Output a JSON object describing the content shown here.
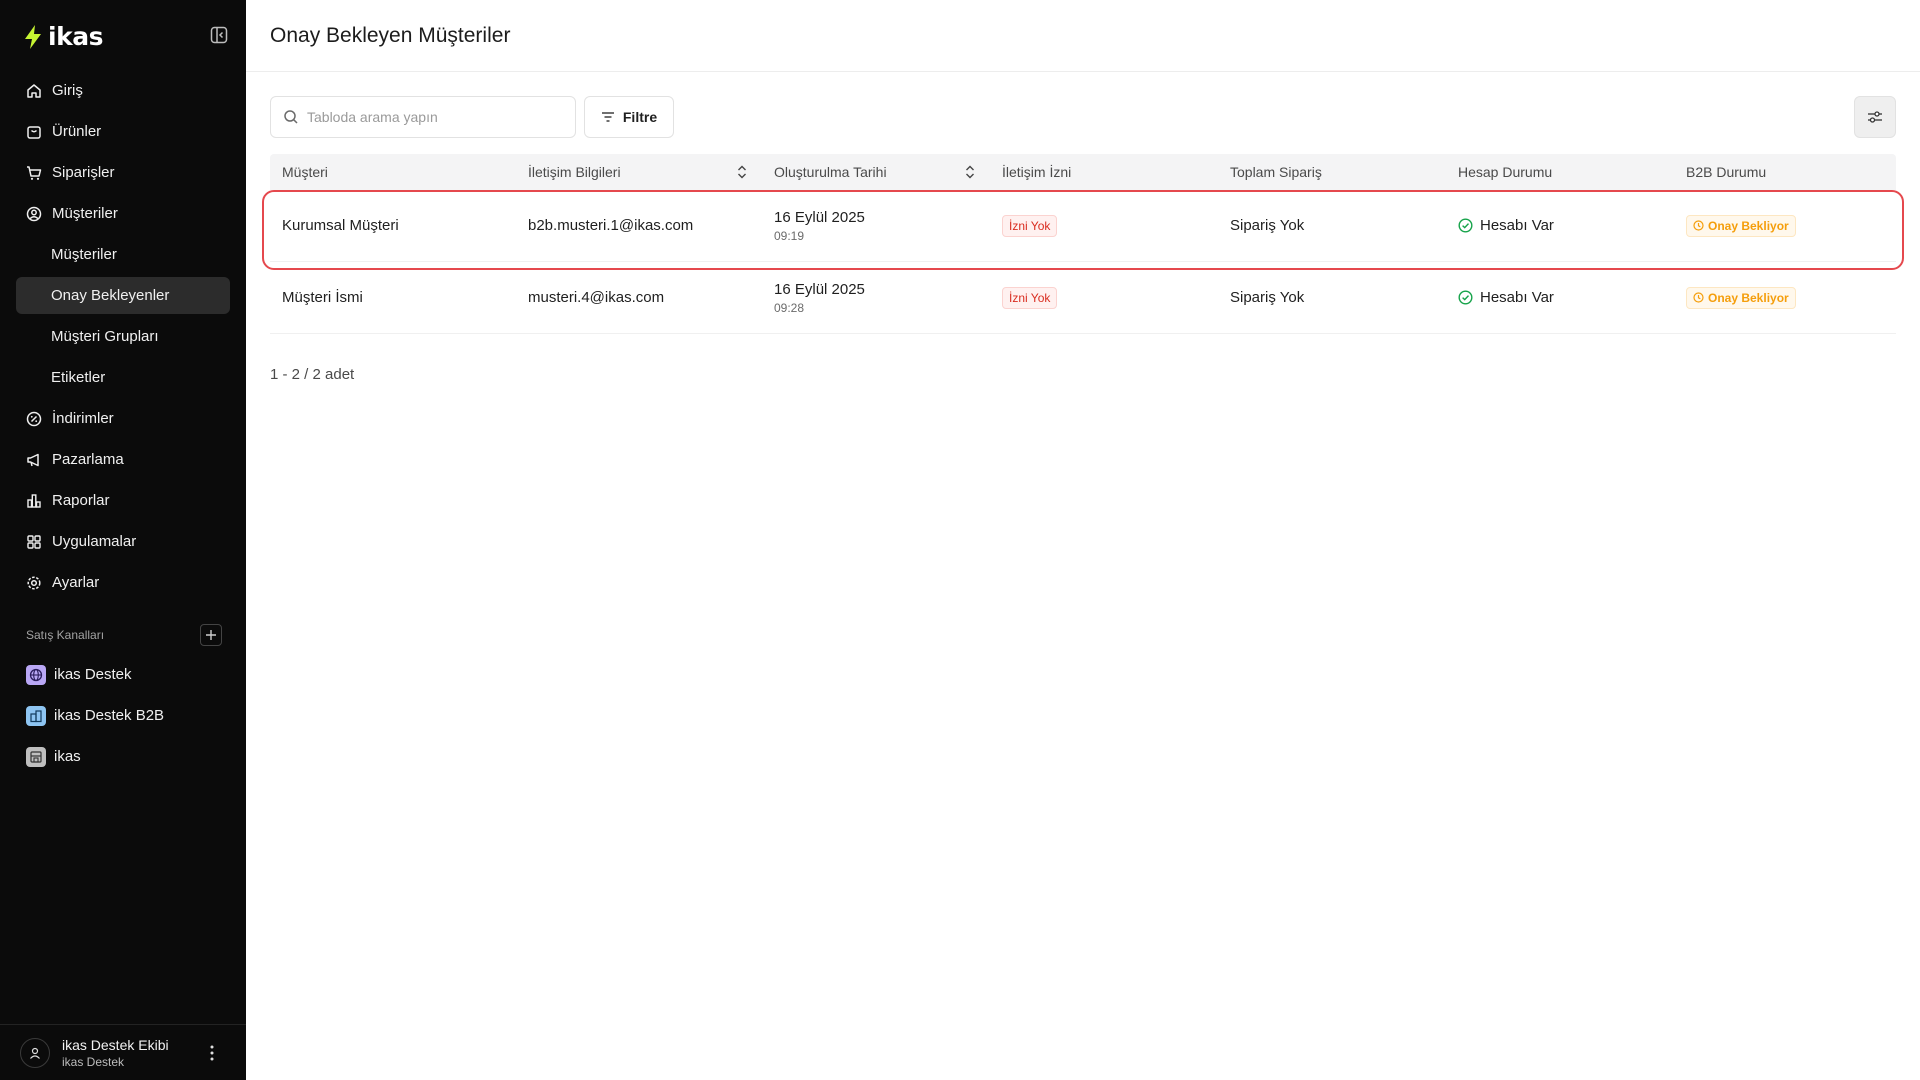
{
  "app": {
    "logo_text": "ikas"
  },
  "sidebar": {
    "items": [
      {
        "label": "Giriş",
        "icon": "home-icon"
      },
      {
        "label": "Ürünler",
        "icon": "box-icon"
      },
      {
        "label": "Siparişler",
        "icon": "cart-icon"
      },
      {
        "label": "Müşteriler",
        "icon": "user-circle-icon"
      },
      {
        "label": "Müşteriler"
      },
      {
        "label": "Onay Bekleyenler",
        "active": true
      },
      {
        "label": "Müşteri Grupları"
      },
      {
        "label": "Etiketler"
      },
      {
        "label": "İndirimler",
        "icon": "discount-icon"
      },
      {
        "label": "Pazarlama",
        "icon": "megaphone-icon"
      },
      {
        "label": "Raporlar",
        "icon": "chart-icon"
      },
      {
        "label": "Uygulamalar",
        "icon": "grid-icon"
      },
      {
        "label": "Ayarlar",
        "icon": "gear-icon"
      }
    ],
    "channels_label": "Satış Kanalları",
    "channels": [
      {
        "label": "ikas Destek",
        "icon": "globe-icon",
        "color": "#b9a7f5"
      },
      {
        "label": "ikas Destek B2B",
        "icon": "building-icon",
        "color": "#8ec5f2"
      },
      {
        "label": "ikas",
        "icon": "store-icon",
        "color": "#bfbfbf"
      }
    ],
    "user": {
      "name": "ikas Destek Ekibi",
      "org": "ikas Destek"
    }
  },
  "page": {
    "title": "Onay Bekleyen Müşteriler"
  },
  "toolbar": {
    "search_placeholder": "Tabloda arama yapın",
    "filter_label": "Filtre"
  },
  "table": {
    "columns": [
      "Müşteri",
      "İletişim Bilgileri",
      "Oluşturulma Tarihi",
      "İletişim İzni",
      "Toplam Sipariş",
      "Hesap Durumu",
      "B2B Durumu"
    ],
    "rows": [
      {
        "customer": "Kurumsal Müşteri",
        "contact": "b2b.musteri.1@ikas.com",
        "date": "16 Eylül 2025",
        "time": "09:19",
        "permission": "İzni Yok",
        "orders": "Sipariş Yok",
        "account": "Hesabı Var",
        "b2b": "Onay Bekliyor"
      },
      {
        "customer": "Müşteri İsmi",
        "contact": "musteri.4@ikas.com",
        "date": "16 Eylül 2025",
        "time": "09:28",
        "permission": "İzni Yok",
        "orders": "Sipariş Yok",
        "account": "Hesabı Var",
        "b2b": "Onay Bekliyor"
      }
    ]
  },
  "pagination": {
    "text": "1 - 2 / 2 adet"
  },
  "colors": {
    "accent_green": "#c6f432",
    "danger": "#d92d20",
    "warning": "#f59e0b",
    "success": "#16a34a"
  }
}
